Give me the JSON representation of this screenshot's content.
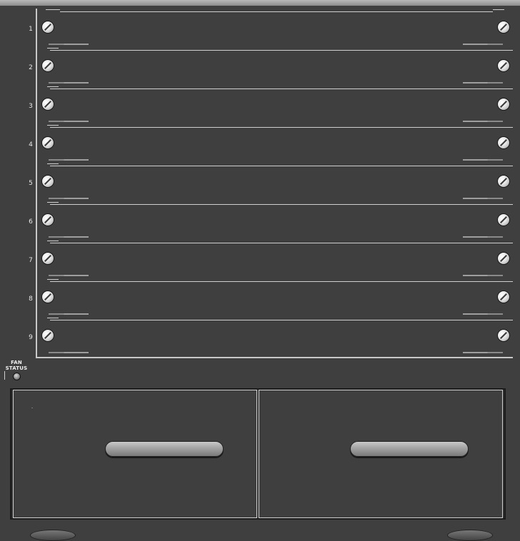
{
  "chassis": {
    "slots": [
      {
        "number": "1"
      },
      {
        "number": "2"
      },
      {
        "number": "3"
      },
      {
        "number": "4"
      },
      {
        "number": "5"
      },
      {
        "number": "6"
      },
      {
        "number": "7"
      },
      {
        "number": "8"
      },
      {
        "number": "9"
      }
    ],
    "fan_status": {
      "label_line1": "FAN",
      "label_line2": "STATUS"
    },
    "power_supplies": [
      {
        "id": "psu-1"
      },
      {
        "id": "psu-2"
      }
    ]
  },
  "colors": {
    "chassis": "#3f3f3f",
    "rail": "#b9b9b9",
    "lines": "#cfcfcf"
  }
}
